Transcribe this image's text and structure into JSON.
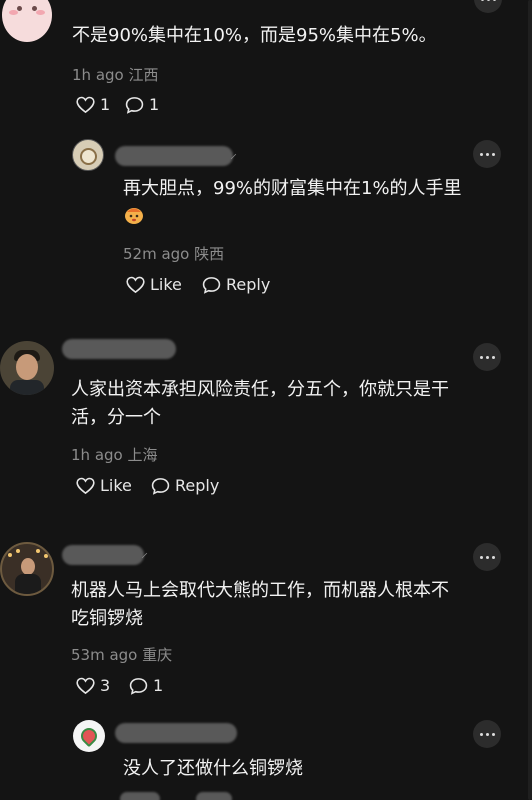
{
  "comments": [
    {
      "text": "不是90%集中在10%，而是95%集中在5%。",
      "time": "1h ago",
      "location": "江西",
      "likes": "1",
      "replies": "1"
    },
    {
      "text": "再大胆点，99%的财富集中在1%的人手里",
      "time": "52m ago",
      "location": "陕西",
      "like_label": "Like",
      "reply_label": "Reply"
    },
    {
      "text_lines": [
        "人家出资本承担风险责任，分五个，你就只是干",
        "活，分一个"
      ],
      "time": "1h ago",
      "location": "上海",
      "like_label": "Like",
      "reply_label": "Reply"
    },
    {
      "text_lines": [
        "机器人马上会取代大熊的工作，而机器人根本不",
        "吃铜锣烧"
      ],
      "time": "53m ago",
      "location": "重庆",
      "likes": "3",
      "replies": "1"
    },
    {
      "text": "没人了还做什么铜锣烧"
    }
  ],
  "colors": {
    "background": "#141414",
    "meta_text": "#8c8c8c",
    "body_text": "#f2f2f2"
  },
  "icons": [
    "heart-icon",
    "comment-bubble-icon",
    "more-dots-icon",
    "baby-emoji"
  ]
}
